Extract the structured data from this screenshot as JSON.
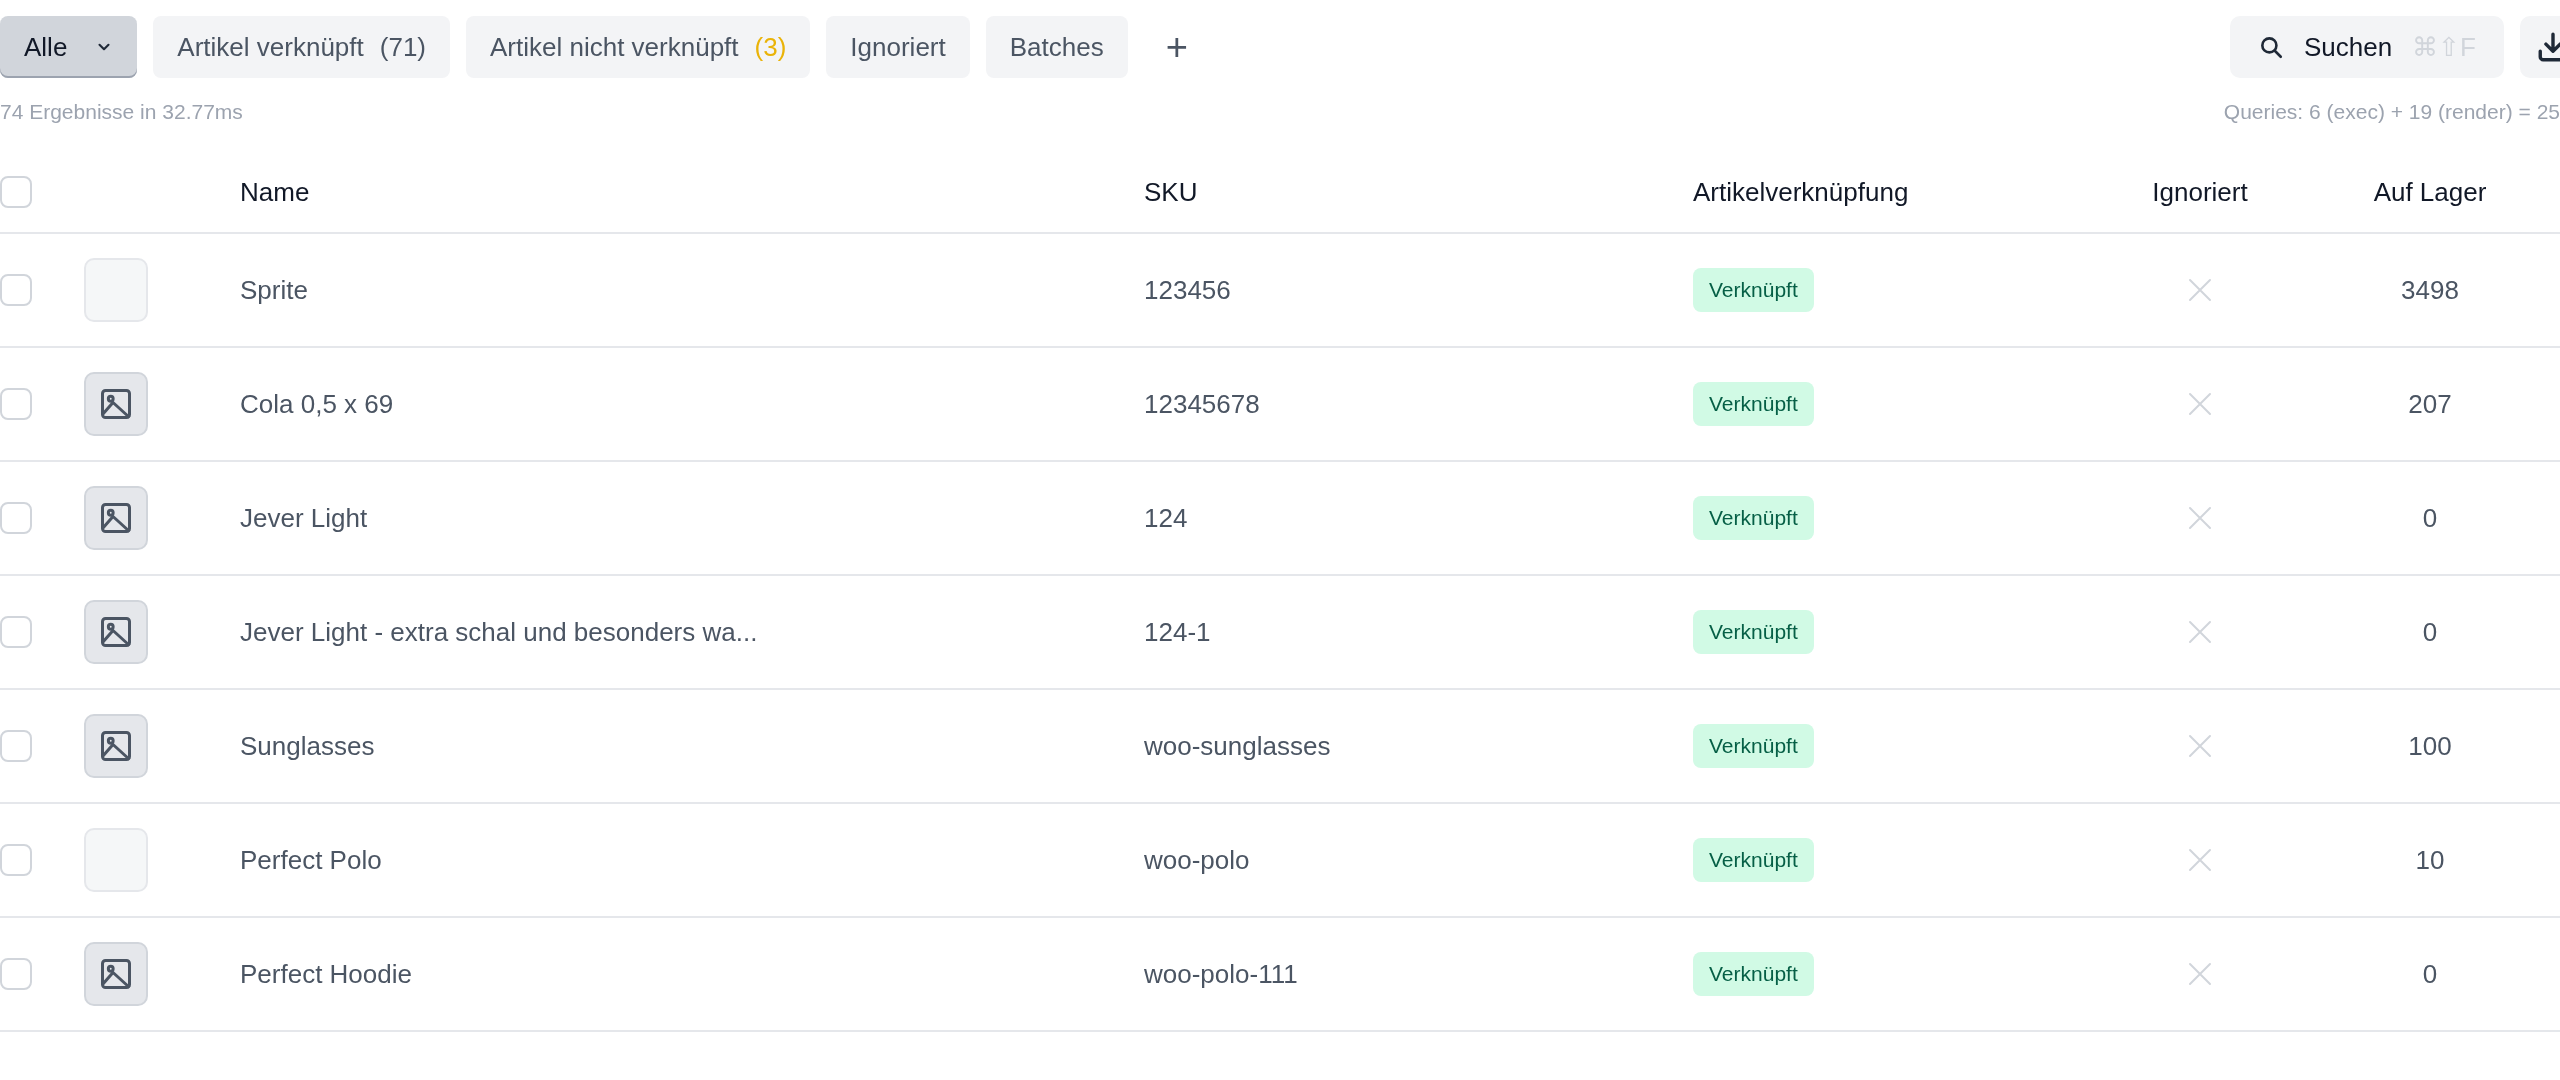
{
  "tabs": [
    {
      "label": "Alle",
      "selected": true,
      "has_menu": true
    },
    {
      "label": "Artikel verknüpft",
      "selected": false,
      "count": {
        "text": "(71)",
        "color": "#4b5563"
      }
    },
    {
      "label": "Artikel nicht verknüpft",
      "selected": false,
      "count": {
        "text": "(3)",
        "color": "#eab308"
      }
    },
    {
      "label": "Ignoriert",
      "selected": false
    },
    {
      "label": "Batches",
      "selected": false
    }
  ],
  "add_tab": "+",
  "search": {
    "label": "Suchen",
    "shortcut": "⌘⇧F"
  },
  "result_info": "74 Ergebnisse in 32.77ms",
  "query_info": "Queries: 6 (exec) + 19 (render) = 25",
  "table": {
    "select_all": {
      "checked": false
    },
    "columns": [
      "Name",
      "SKU",
      "Artikelverknüpfung",
      "Ignoriert",
      "Auf Lager"
    ],
    "rows": [
      {
        "checked": false,
        "kind": "photo",
        "name": "Sprite",
        "sku": "123456",
        "status": {
          "text": "Verknüpft",
          "kind": "linked"
        },
        "ignored": false,
        "stock": "3498"
      },
      {
        "checked": false,
        "kind": "placeholder",
        "name": "Cola 0,5 x 69",
        "sku": "12345678",
        "status": {
          "text": "Verknüpft",
          "kind": "linked"
        },
        "ignored": false,
        "stock": "207"
      },
      {
        "checked": false,
        "kind": "placeholder",
        "name": "Jever Light",
        "sku": "124",
        "status": {
          "text": "Verknüpft",
          "kind": "linked"
        },
        "ignored": false,
        "stock": "0"
      },
      {
        "checked": false,
        "kind": "placeholder",
        "name": "Jever Light - extra schal und besonders wa...",
        "sku": "124-1",
        "status": {
          "text": "Verknüpft",
          "kind": "linked"
        },
        "ignored": false,
        "stock": "0"
      },
      {
        "checked": false,
        "kind": "placeholder",
        "name": "Sunglasses",
        "sku": "woo-sunglasses",
        "status": {
          "text": "Verknüpft",
          "kind": "linked"
        },
        "ignored": false,
        "stock": "100"
      },
      {
        "checked": false,
        "kind": "photo",
        "name": "Perfect Polo",
        "sku": "woo-polo",
        "status": {
          "text": "Verknüpft",
          "kind": "linked"
        },
        "ignored": false,
        "stock": "10"
      },
      {
        "checked": false,
        "kind": "placeholder",
        "name": "Perfect Hoodie",
        "sku": "woo-polo-111",
        "status": {
          "text": "Verknüpft",
          "kind": "linked"
        },
        "ignored": false,
        "stock": "0"
      }
    ]
  }
}
